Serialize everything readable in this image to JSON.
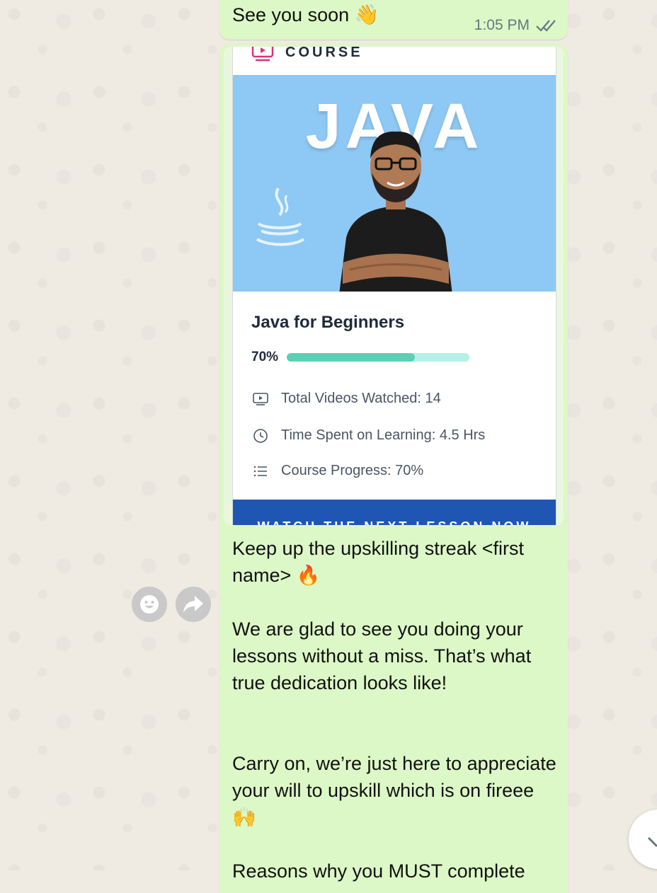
{
  "top_message": {
    "text": "See you soon",
    "emoji": "👋",
    "time": "1:05 PM"
  },
  "card": {
    "header_label": "COURSE",
    "hero_title": "JAVA",
    "course_name": "Java for Beginners",
    "progress_label": "70%",
    "progress_value": 0.7,
    "stats": [
      {
        "icon": "video-icon",
        "text": "Total Videos Watched: 14"
      },
      {
        "icon": "clock-icon",
        "text": "Time Spent on Learning: 4.5 Hrs"
      },
      {
        "icon": "list-icon",
        "text": "Course Progress: 70%"
      }
    ],
    "cta_label": "WATCH THE NEXT LESSON NOW"
  },
  "message_body": "Keep up the upskilling streak <first name> 🔥\n\nWe are glad to see you doing your lessons without a miss. That’s what true dedication looks like!\n\n\nCarry on, we’re just here to appreciate your will to upskill which is on fireee 🙌\n\nReasons why you MUST complete",
  "actions": {
    "react_icon": "smiley-icon",
    "forward_icon": "forward-icon"
  },
  "colors": {
    "bubble": "#dcf8c6",
    "accent": "#1f56b3",
    "progress": "#5ccfb5",
    "progress_track": "#b5f0e8",
    "hero_bg": "#8ec8f4"
  }
}
